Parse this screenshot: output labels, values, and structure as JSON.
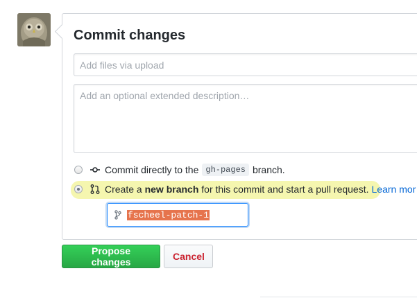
{
  "commit_form": {
    "title": "Commit changes",
    "summary_placeholder": "Add files via upload",
    "description_placeholder": "Add an optional extended description…",
    "options": {
      "direct": {
        "prefix": "Commit directly to the",
        "branch": "gh-pages",
        "suffix": "branch.",
        "selected": false
      },
      "new_branch": {
        "prefix": "Create a",
        "bold": "new branch",
        "suffix": "for this commit and start a pull request.",
        "link": "Learn mor",
        "selected": true
      }
    },
    "branch_name": "fscheel-patch-1"
  },
  "buttons": {
    "propose": "Propose changes",
    "cancel": "Cancel"
  },
  "colors": {
    "primary_button": "#28a745",
    "cancel_text": "#cb2431",
    "link": "#0366d6",
    "highlight": "#ecee6e",
    "selected_text_bg": "#e6744d"
  },
  "icons": {
    "commit": "git-commit-icon",
    "pull_request": "git-pull-request-icon",
    "branch": "git-branch-icon"
  }
}
